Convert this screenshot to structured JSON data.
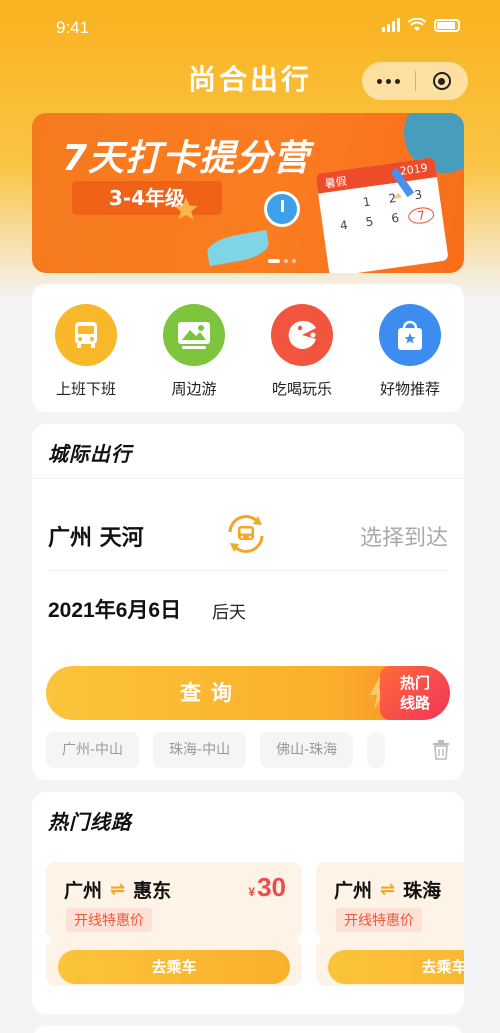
{
  "status_bar": {
    "time": "9:41"
  },
  "header": {
    "title": "尚合出行"
  },
  "banner": {
    "title": "7天打卡提分营",
    "subtitle": "3-4年级",
    "calendar_year": "2019",
    "calendar_month": "暑假",
    "calendar_days": [
      "1",
      "2",
      "3",
      "4",
      "5",
      "6",
      "7"
    ]
  },
  "quick_entries": [
    {
      "label": "上班下班",
      "icon": "bus-icon",
      "color": "#f9b72a"
    },
    {
      "label": "周边游",
      "icon": "mountain-icon",
      "color": "#7cc53c"
    },
    {
      "label": "吃喝玩乐",
      "icon": "pacman-icon",
      "color": "#f2553e"
    },
    {
      "label": "好物推荐",
      "icon": "shopping-bag-icon",
      "color": "#3d8df0"
    }
  ],
  "intercity": {
    "title": "城际出行",
    "from": "广州 天河",
    "to_placeholder": "选择到达",
    "date": "2021年6月6日",
    "date_hint": "后天",
    "query_label": "查询",
    "hot_tag_line1": "热门",
    "hot_tag_line2": "线路",
    "history": [
      "广州-中山",
      "珠海-中山",
      "佛山-珠海"
    ]
  },
  "hot_routes": {
    "title": "热门线路",
    "routes": [
      {
        "from": "广州",
        "to": "惠东",
        "currency": "¥",
        "price": "30",
        "promo": "开线特惠价",
        "action": "去乘车"
      },
      {
        "from": "广州",
        "to": "珠海",
        "promo": "开线特惠价",
        "action": "去乘车"
      }
    ]
  },
  "colors": {
    "brand": "#fab02c",
    "accent_red": "#f04b4b"
  }
}
